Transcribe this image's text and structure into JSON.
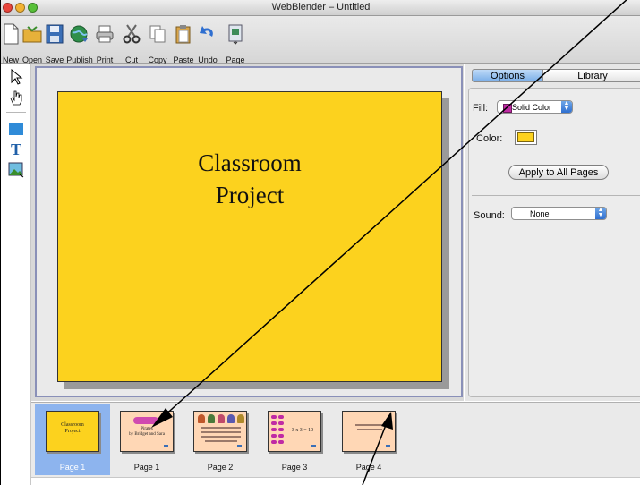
{
  "window": {
    "title": "WebBlender – Untitled"
  },
  "toolbar": {
    "items": [
      {
        "label": "New",
        "icon": "new-document-icon"
      },
      {
        "label": "Open",
        "icon": "open-folder-icon"
      },
      {
        "label": "Save",
        "icon": "floppy-disk-icon"
      },
      {
        "label": "Publish",
        "icon": "globe-icon"
      },
      {
        "label": "Print",
        "icon": "printer-icon"
      },
      {
        "label": "Cut",
        "icon": "scissors-icon"
      },
      {
        "label": "Copy",
        "icon": "copy-icon"
      },
      {
        "label": "Paste",
        "icon": "clipboard-icon"
      },
      {
        "label": "Undo",
        "icon": "undo-arrow-icon"
      },
      {
        "label": "Page",
        "icon": "page-icon"
      }
    ]
  },
  "tools": [
    "arrow-pointer-icon",
    "hand-icon",
    "rectangle-icon",
    "text-tool-icon",
    "image-tool-icon"
  ],
  "slide": {
    "title_line1": "Classroom",
    "title_line2": "Project",
    "background": "#fcd21e"
  },
  "panel": {
    "tabs": [
      "Options",
      "Library"
    ],
    "active_tab": "Options",
    "fill_label": "Fill:",
    "fill_value": "Solid Color",
    "color_label": "Color:",
    "color_value": "#fcd21e",
    "apply_button": "Apply to All Pages",
    "sound_label": "Sound:",
    "sound_value": "None"
  },
  "filmstrip": {
    "pages": [
      {
        "label": "Page 1",
        "selected": true,
        "thumb_lines": [
          "Classroom",
          "Project"
        ],
        "color": "#fcd21e"
      },
      {
        "label": "Page 1",
        "selected": false,
        "thumb_lines": [
          "Pirates",
          "by Bridget and Sara"
        ],
        "color": "#ffd7b5"
      },
      {
        "label": "Page 2",
        "selected": false,
        "thumb_lines": [],
        "color": "#ffd7b5"
      },
      {
        "label": "Page 3",
        "selected": false,
        "thumb_lines": [
          "3 x 3 = 10"
        ],
        "color": "#ffd7b5"
      },
      {
        "label": "Page 4",
        "selected": false,
        "thumb_lines": [],
        "color": "#ffd7b5"
      }
    ]
  }
}
